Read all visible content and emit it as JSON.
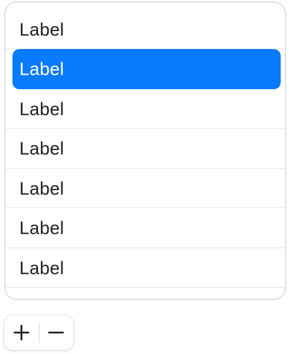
{
  "list": {
    "items": [
      {
        "label": "Label",
        "selected": false
      },
      {
        "label": "Label",
        "selected": true
      },
      {
        "label": "Label",
        "selected": false
      },
      {
        "label": "Label",
        "selected": false
      },
      {
        "label": "Label",
        "selected": false
      },
      {
        "label": "Label",
        "selected": false
      },
      {
        "label": "Label",
        "selected": false
      }
    ]
  },
  "controls": {
    "add_icon": "plus-icon",
    "remove_icon": "minus-icon"
  },
  "colors": {
    "selection": "#0a7aff",
    "text": "#222222",
    "selected_text": "#ffffff",
    "border": "#e3e3e3"
  }
}
